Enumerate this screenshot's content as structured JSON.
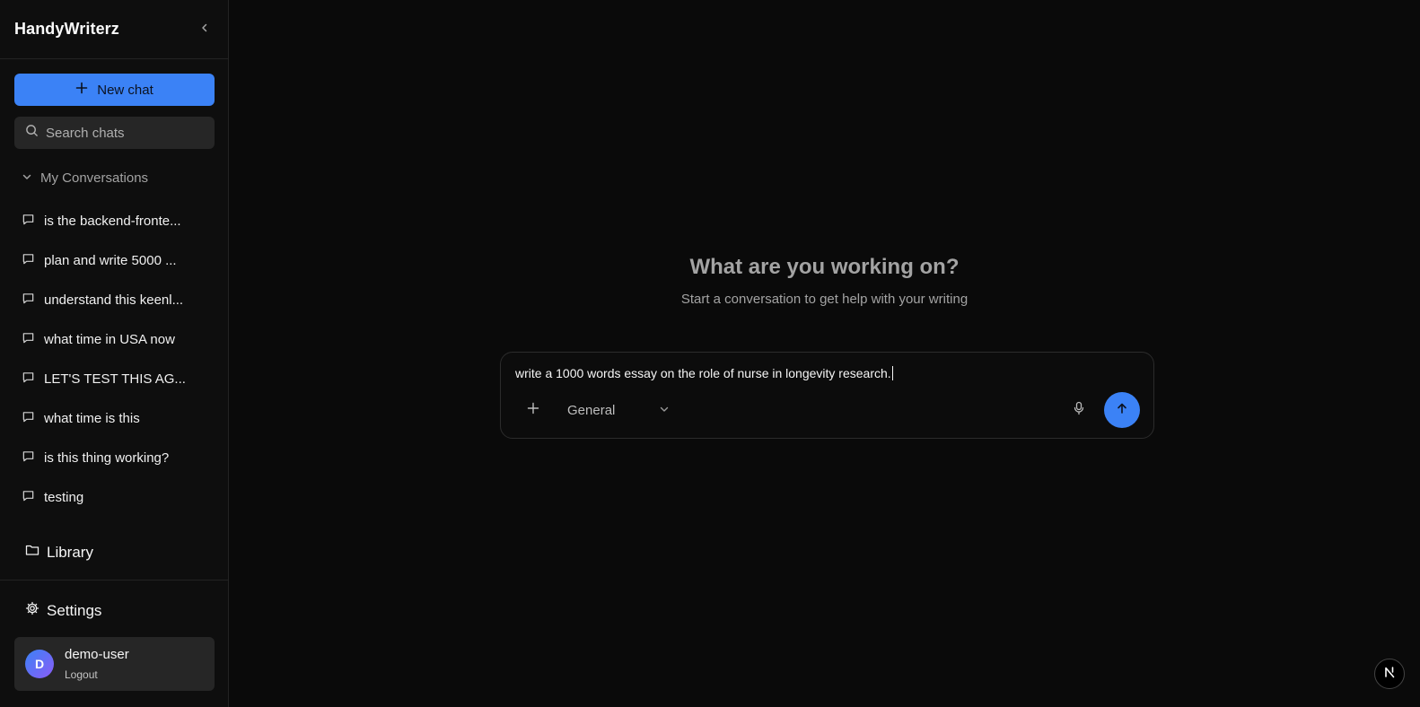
{
  "app": {
    "brand": "HandyWriterz"
  },
  "sidebar": {
    "new_chat_label": "New chat",
    "search_placeholder": "Search chats",
    "section_title": "My Conversations",
    "conversations": [
      {
        "label": "is the backend-fronte..."
      },
      {
        "label": "plan and write 5000 ..."
      },
      {
        "label": "understand this keenl..."
      },
      {
        "label": "what time in USA now"
      },
      {
        "label": "LET'S TEST THIS AG..."
      },
      {
        "label": "what time is this"
      },
      {
        "label": "is this thing working?"
      },
      {
        "label": "testing"
      }
    ],
    "library_label": "Library",
    "settings_label": "Settings",
    "user": {
      "initial": "D",
      "name": "demo-user",
      "logout_label": "Logout"
    }
  },
  "main": {
    "title": "What are you working on?",
    "subtitle": "Start a conversation to get help with your writing",
    "composer": {
      "text": "write a 1000 words essay on the role of nurse in longevity research.",
      "mode": "General"
    }
  },
  "colors": {
    "accent": "#3b82f6",
    "background": "#0a0a0a",
    "sidebar": "#0e0e0e"
  },
  "icons": [
    "chevron-left-icon",
    "plus-icon",
    "search-icon",
    "chevron-down-icon",
    "message-icon",
    "folder-icon",
    "gear-icon",
    "mic-icon",
    "arrow-up-icon",
    "next-logo-icon"
  ]
}
